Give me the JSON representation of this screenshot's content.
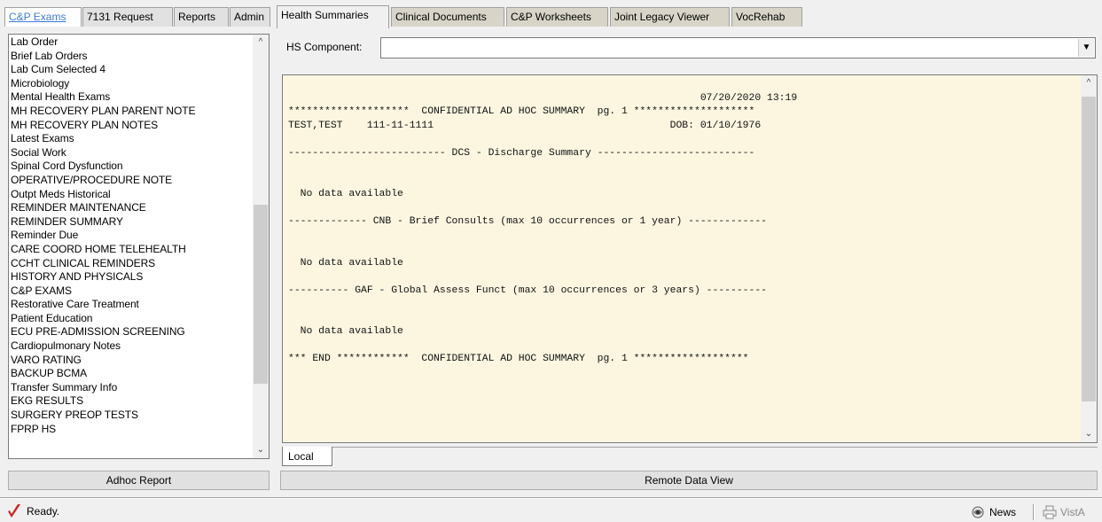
{
  "tabs_left": [
    "C&P Exams",
    "7131 Request",
    "Reports",
    "Admin"
  ],
  "tabs_right": [
    "Health Summaries",
    "Clinical Documents",
    "C&P Worksheets",
    "Joint Legacy Viewer",
    "VocRehab"
  ],
  "left_list": {
    "items": [
      "Lab Order",
      "Brief Lab Orders",
      "Lab Cum Selected 4",
      "Microbiology",
      "Mental Health Exams",
      "MH RECOVERY PLAN PARENT NOTE",
      "MH RECOVERY PLAN NOTES",
      "Latest Exams",
      "Social Work",
      "Spinal Cord Dysfunction",
      "OPERATIVE/PROCEDURE NOTE",
      "Outpt Meds Historical",
      "REMINDER MAINTENANCE",
      "REMINDER SUMMARY",
      "Reminder Due",
      "CARE COORD HOME TELEHEALTH",
      "CCHT CLINICAL REMINDERS",
      "HISTORY AND PHYSICALS",
      "C&P EXAMS",
      "Restorative Care Treatment",
      "Patient Education",
      "ECU PRE-ADMISSION SCREENING",
      "Cardiopulmonary Notes",
      "VARO RATING",
      "BACKUP BCMA",
      "Transfer Summary Info",
      "EKG RESULTS",
      "SURGERY PREOP TESTS",
      "FPRP HS"
    ],
    "button_label": "Adhoc Report"
  },
  "hs_component": {
    "label": "HS Component:",
    "value": ""
  },
  "report": {
    "lines": [
      "",
      "                                                                    07/20/2020 13:19",
      "********************  CONFIDENTIAL AD HOC SUMMARY  pg. 1 ********************",
      "TEST,TEST    111-11-1111                                       DOB: 01/10/1976",
      "",
      "-------------------------- DCS - Discharge Summary --------------------------",
      "",
      "",
      "  No data available",
      "",
      "------------- CNB - Brief Consults (max 10 occurrences or 1 year) -------------",
      "",
      "",
      "  No data available",
      "",
      "---------- GAF - Global Assess Funct (max 10 occurrences or 3 years) ----------",
      "",
      "",
      "  No data available",
      "",
      "*** END ************  CONFIDENTIAL AD HOC SUMMARY  pg. 1 *******************"
    ]
  },
  "bottom_tab": "Local",
  "remote_button": "Remote Data View",
  "status": {
    "text": "Ready.",
    "news_label": "News",
    "vista_label": "VistA"
  },
  "colors": {
    "report_background": "#fcf6e0",
    "active_tab_text": "#3a7bd5",
    "check_red": "#d42020"
  }
}
